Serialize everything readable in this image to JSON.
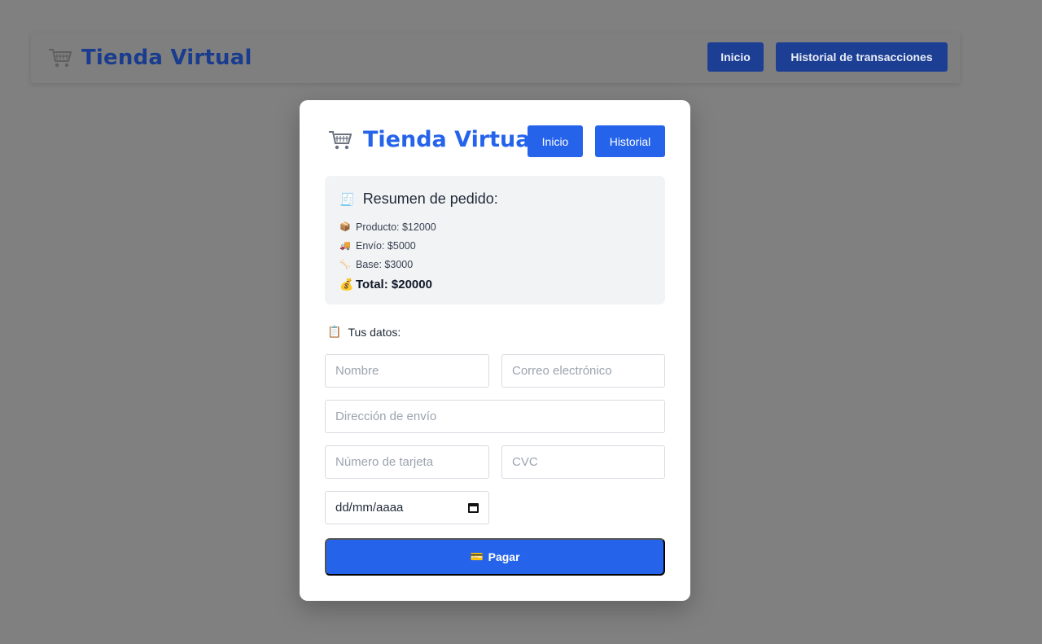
{
  "background_header": {
    "brand": "Tienda Virtual",
    "nav": {
      "inicio": "Inicio",
      "historial": "Historial de transacciones"
    }
  },
  "modal": {
    "brand": "Tienda Virtual",
    "nav": {
      "inicio": "Inicio",
      "historial": "Historial"
    },
    "summary": {
      "title": "Resumen de pedido:",
      "producto": "Producto: $12000",
      "envio": "Envío: $5000",
      "base": "Base: $3000",
      "total": "Total: $20000"
    },
    "form": {
      "section_title": "Tus datos:",
      "nombre_placeholder": "Nombre",
      "correo_placeholder": "Correo electrónico",
      "direccion_placeholder": "Dirección de envío",
      "tarjeta_placeholder": "Número de tarjeta",
      "cvc_placeholder": "CVC",
      "fecha_value": "dd/mm/aaaa",
      "pay_label": "Pagar"
    }
  },
  "icons": [
    "cart-icon",
    "receipt-icon",
    "box-icon",
    "truck-icon",
    "bone-icon",
    "money-bag-icon",
    "clipboard-icon",
    "calendar-icon",
    "credit-card-icon"
  ],
  "colors": {
    "brand_blue": "#2563eb",
    "dim_blue": "#1c3f94",
    "overlay": "#808080"
  }
}
